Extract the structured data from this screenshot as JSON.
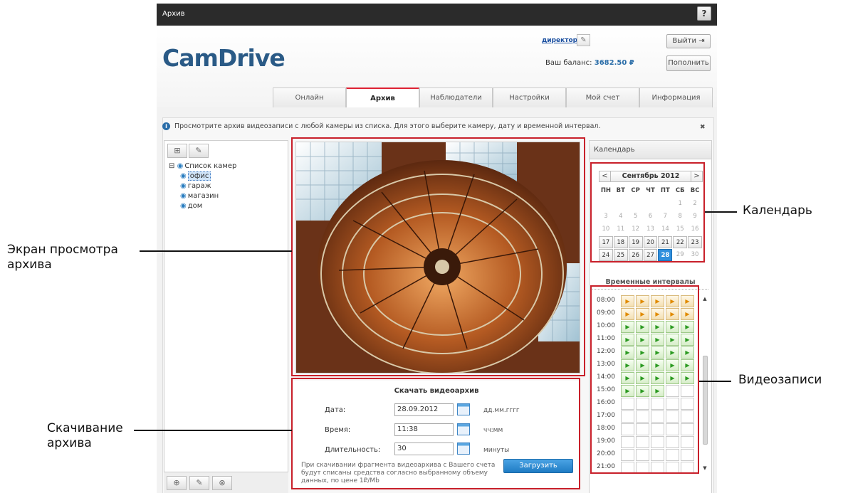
{
  "window": {
    "title": "Архив",
    "help_label": "?"
  },
  "header": {
    "logo": "CamDrive",
    "user": "директор",
    "edit_icon": "pencil-icon",
    "balance_label": "Ваш баланс:",
    "balance_value": "3682.50 ₽",
    "logout": "Выйти",
    "topup": "Пополнить"
  },
  "tabs": [
    {
      "label": "Онлайн",
      "active": false
    },
    {
      "label": "Архив",
      "active": true
    },
    {
      "label": "Наблюдатели",
      "active": false
    },
    {
      "label": "Настройки",
      "active": false
    },
    {
      "label": "Мой счет",
      "active": false
    },
    {
      "label": "Информация",
      "active": false
    }
  ],
  "info": {
    "text": "Просмотрите архив видеозаписи с любой камеры из списка. Для этого выберите камеру, дату и временной интервал.",
    "close": "✖"
  },
  "cameras": {
    "root": "Список камер",
    "items": [
      "офис",
      "гараж",
      "магазин",
      "дом"
    ],
    "selected": "офис"
  },
  "download": {
    "title": "Скачать видеоархив",
    "date_label": "Дата:",
    "date_value": "28.09.2012",
    "date_hint": "дд.мм.гггг",
    "time_label": "Время:",
    "time_value": "11:38",
    "time_hint": "чч:мм",
    "duration_label": "Длительность:",
    "duration_value": "30",
    "duration_hint": "минуты",
    "note": "При скачивании фрагмента видеоархива с Вашего счета будут списаны средства согласно выбранному объему данных, по цене 1₽/Mb",
    "button": "Загрузить"
  },
  "calendar": {
    "header": "Календарь",
    "month": "Сентябрь 2012",
    "prev": "<",
    "next": ">",
    "weekdays": [
      "ПН",
      "ВТ",
      "СР",
      "ЧТ",
      "ПТ",
      "СБ",
      "ВС"
    ],
    "weeks": [
      [
        "",
        "",
        "",
        "",
        "",
        "1",
        "2"
      ],
      [
        "3",
        "4",
        "5",
        "6",
        "7",
        "8",
        "9"
      ],
      [
        "10",
        "11",
        "12",
        "13",
        "14",
        "15",
        "16"
      ],
      [
        "17",
        "18",
        "19",
        "20",
        "21",
        "22",
        "23"
      ],
      [
        "24",
        "25",
        "26",
        "27",
        "28",
        "29",
        "30"
      ]
    ],
    "available_days": [
      "17",
      "18",
      "19",
      "20",
      "21",
      "22",
      "23",
      "24",
      "25",
      "26",
      "27"
    ],
    "current_day": "28"
  },
  "intervals": {
    "title": "Временные интервалы",
    "rows": [
      {
        "time": "08:00",
        "cells": [
          "orange",
          "orange",
          "orange",
          "orange",
          "orange"
        ]
      },
      {
        "time": "09:00",
        "cells": [
          "orange",
          "orange",
          "orange",
          "orange",
          "orange"
        ]
      },
      {
        "time": "10:00",
        "cells": [
          "green",
          "green",
          "green",
          "green",
          "green"
        ]
      },
      {
        "time": "11:00",
        "cells": [
          "green",
          "green",
          "green",
          "green",
          "green"
        ]
      },
      {
        "time": "12:00",
        "cells": [
          "green",
          "green",
          "green",
          "green",
          "green"
        ]
      },
      {
        "time": "13:00",
        "cells": [
          "green",
          "green",
          "green",
          "green",
          "green"
        ]
      },
      {
        "time": "14:00",
        "cells": [
          "green",
          "green",
          "green",
          "green",
          "green"
        ]
      },
      {
        "time": "15:00",
        "cells": [
          "green",
          "green",
          "green",
          "empty",
          "empty"
        ]
      },
      {
        "time": "16:00",
        "cells": [
          "empty",
          "empty",
          "empty",
          "empty",
          "empty"
        ]
      },
      {
        "time": "17:00",
        "cells": [
          "empty",
          "empty",
          "empty",
          "empty",
          "empty"
        ]
      },
      {
        "time": "18:00",
        "cells": [
          "empty",
          "empty",
          "empty",
          "empty",
          "empty"
        ]
      },
      {
        "time": "19:00",
        "cells": [
          "empty",
          "empty",
          "empty",
          "empty",
          "empty"
        ]
      },
      {
        "time": "20:00",
        "cells": [
          "empty",
          "empty",
          "empty",
          "empty",
          "empty"
        ]
      },
      {
        "time": "21:00",
        "cells": [
          "empty",
          "empty",
          "empty",
          "empty",
          "empty"
        ]
      }
    ]
  },
  "callouts": {
    "viewer": "Экран просмотра\nархива",
    "calendar": "Календарь",
    "records": "Видеозаписи",
    "download": "Скачивание\nархива"
  },
  "colors": {
    "accent": "#2f8fdd",
    "annotation": "#c8202a",
    "brand": "#2a5a86"
  }
}
